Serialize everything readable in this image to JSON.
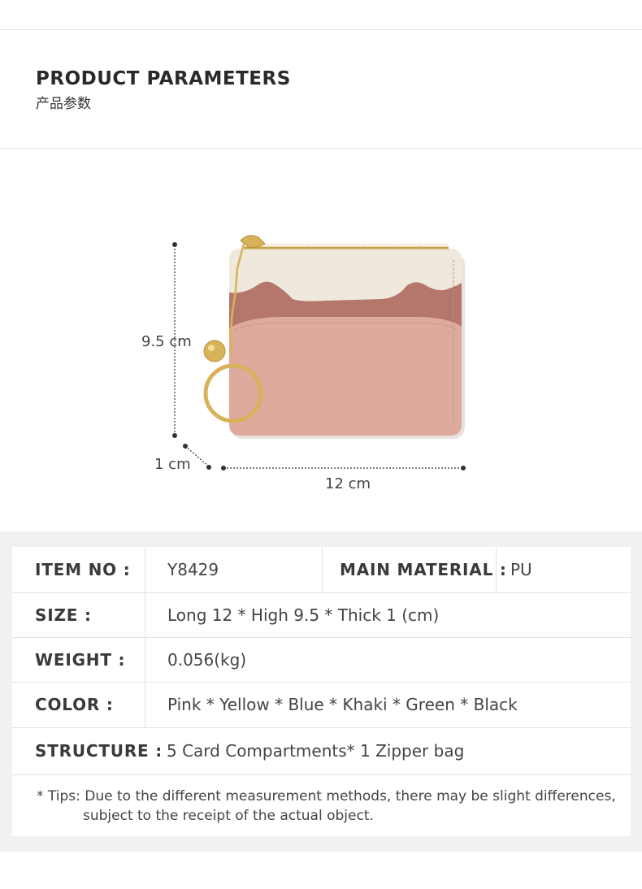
{
  "header": {
    "title": "PRODUCT PARAMETERS",
    "subtitle": "产品参数"
  },
  "dimensions": {
    "height": "9.5 cm",
    "depth": "1 cm",
    "length": "12 cm"
  },
  "product_colors": {
    "cream": "#efe8dc",
    "mauve": "#b5776b",
    "pink": "#deaa9d",
    "gold": "#d8b25a"
  },
  "params": {
    "item_no_label": "ITEM NO :",
    "item_no": "Y8429",
    "material_label": "MAIN MATERIAL :",
    "material": "PU",
    "size_label": "SIZE :",
    "size": "Long 12 * High 9.5 * Thick  1 (cm)",
    "weight_label": "WEIGHT :",
    "weight": "0.056(kg)",
    "color_label": "COLOR :",
    "color": "Pink * Yellow * Blue * Khaki * Green * Black",
    "structure_label": "STRUCTURE :",
    "structure": "5 Card Compartments* 1 Zipper bag"
  },
  "tips": {
    "line1": "* Tips: Due to the different measurement methods, there may be slight differences,",
    "line2": "subject to the receipt of the actual object."
  }
}
